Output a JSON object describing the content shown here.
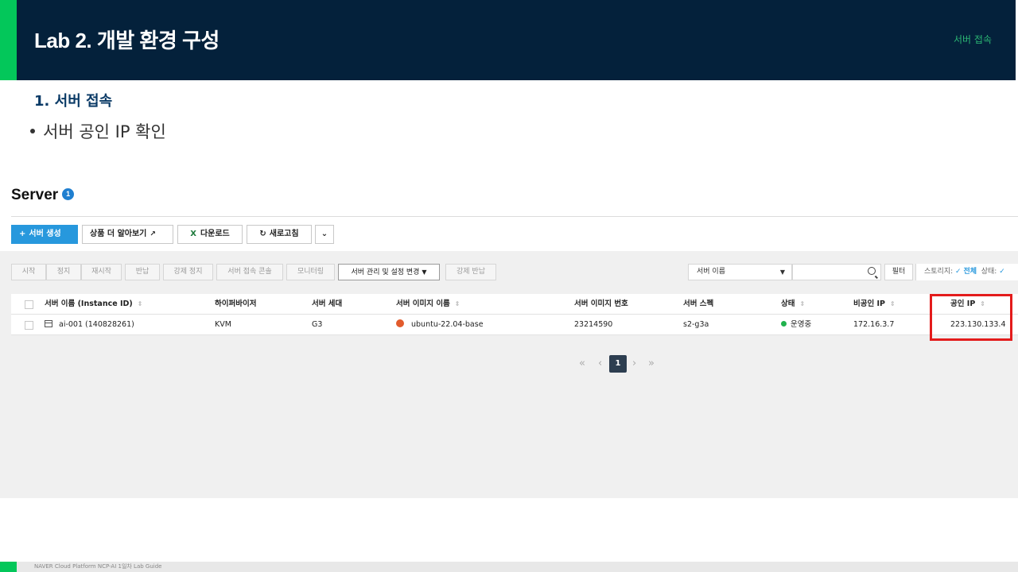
{
  "slide": {
    "title": "Lab 2. 개발 환경 구성",
    "section": "서버 접속",
    "heading": "1.  서버 접속",
    "bullet": "서버 공인 IP 확인",
    "footer": "NAVER Cloud Platform  NCP-AI 1일차 Lab Guide"
  },
  "console": {
    "title": "Server",
    "count": "1",
    "buttons": {
      "create": "서버 생성",
      "learn_more": "상품 더 알아보기",
      "download": "다운로드",
      "refresh": "새로고침"
    },
    "toolbar": {
      "start": "시작",
      "stop": "정지",
      "restart": "재시작",
      "return": "반납",
      "force_stop": "강제 정지",
      "console": "서버 접속 콘솔",
      "monitoring": "모니터링",
      "manage": "서버 관리 및 설정 변경",
      "force_return": "강제 반납"
    },
    "filter": {
      "select": "서버 이름",
      "button": "필터",
      "storage_label": "스토리지:",
      "storage_value": "전체",
      "status_label": "상태:"
    },
    "table": {
      "headers": [
        "서버 이름 (Instance ID)",
        "하이퍼바이저",
        "서버 세대",
        "서버 이미지 이름",
        "서버 이미지 번호",
        "서버 스펙",
        "상태",
        "비공인 IP",
        "공인 IP"
      ],
      "rows": [
        {
          "name": "ai-001 (140828261)",
          "hypervisor": "KVM",
          "generation": "G3",
          "image_name": "ubuntu-22.04-base",
          "image_no": "23214590",
          "spec": "s2-g3a",
          "status": "운영중",
          "private_ip": "172.16.3.7",
          "public_ip": "223.130.133.4"
        }
      ]
    },
    "pager": {
      "current": "1"
    }
  },
  "colors": {
    "header_bg": "#04213b",
    "brand_green": "#03c75a",
    "primary_button": "#2798dd",
    "highlight": "#e31b1b",
    "status_running": "#20b24d"
  }
}
